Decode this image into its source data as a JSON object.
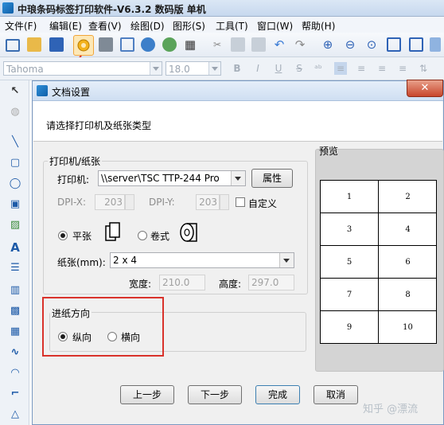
{
  "app": {
    "title": "中琅条码标签打印软件-V6.3.2 数码版 单机"
  },
  "menu": [
    {
      "label": "文件(F)"
    },
    {
      "label": "编辑(E)"
    },
    {
      "label": "查看(V)"
    },
    {
      "label": "绘图(D)"
    },
    {
      "label": "图形(S)"
    },
    {
      "label": "工具(T)"
    },
    {
      "label": "窗口(W)"
    },
    {
      "label": "帮助(H)"
    }
  ],
  "format_bar": {
    "font": "Tahoma",
    "size": "18.0",
    "bold": "B",
    "italic": "I",
    "underline": "U",
    "strike": "S"
  },
  "toolbox": [
    "select-tool",
    "barcode-tool",
    "line-tool",
    "rectangle-tool",
    "ellipse-tool",
    "image-tool",
    "picture-tool",
    "text-tool",
    "paragraph-tool",
    "barcode-1d-tool",
    "qrcode-tool",
    "curve-tool",
    "arc-tool",
    "polygon-tool",
    "triangle-tool"
  ],
  "dialog": {
    "title": "文档设置",
    "close": "✕",
    "header_text": "请选择打印机及纸张类型",
    "printer_group": {
      "label": "打印机/纸张",
      "printer_label": "打印机:",
      "printer_value": "\\\\server\\TSC TTP-244 Pro",
      "properties_button": "属性",
      "dpix_label": "DPI-X:",
      "dpix_value": "203",
      "dpiy_label": "DPI-Y:",
      "dpiy_value": "203",
      "custom_label": "自定义",
      "flat_label": "平张",
      "roll_label": "卷式",
      "paper_label": "纸张(mm):",
      "paper_value": "2 x 4",
      "width_label": "宽度:",
      "width_value": "210.0",
      "height_label": "高度:",
      "height_value": "297.0"
    },
    "feed_group": {
      "label": "进纸方向",
      "portrait": "纵向",
      "landscape": "横向"
    },
    "preview": {
      "label": "预览",
      "cells": [
        "1",
        "2",
        "3",
        "4",
        "5",
        "6",
        "7",
        "8",
        "9",
        "10"
      ]
    },
    "buttons": {
      "prev": "上一步",
      "next": "下一步",
      "finish": "完成",
      "cancel": "取消"
    }
  },
  "watermark": "知乎 @漂流",
  "colors": {
    "annotation_red": "#d9322b",
    "accent_blue": "#1d5aa8"
  }
}
